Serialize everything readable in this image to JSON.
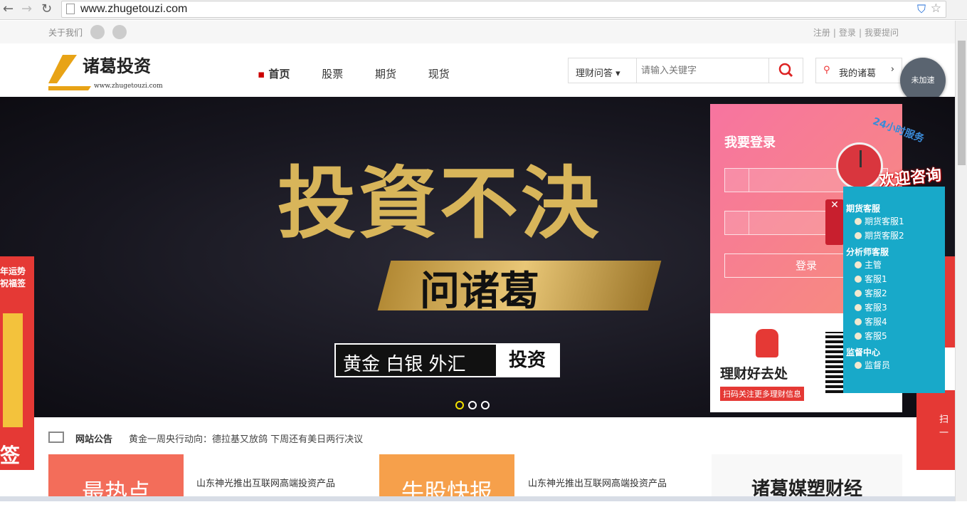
{
  "browser": {
    "url": "www.zhugetouzi.com"
  },
  "topbar": {
    "left": "关于我们",
    "links": [
      "注册",
      "登录",
      "我要提问"
    ]
  },
  "header": {
    "logo_text": "诸葛投资",
    "logo_sub": "www.zhugetouzi.com",
    "nav": [
      "首页",
      "股票",
      "期货",
      "现货"
    ],
    "search_select": "理财问答",
    "search_placeholder": "请输入关键字",
    "my_label": "我的诸葛",
    "speed_label": "未加速"
  },
  "banner": {
    "headline": "投資不決",
    "sub": "问诸葛",
    "tags": "黄金 白银 外汇",
    "tag_highlight": "投资"
  },
  "login": {
    "title": "我要登录",
    "button": "登录"
  },
  "qr": {
    "title": "理财好去处",
    "subtitle": "扫码关注更多理财信息"
  },
  "service": {
    "badge": "24小时服务",
    "welcome": "欢迎咨询",
    "groups": [
      {
        "title": "期货客服",
        "items": [
          "期货客服1",
          "期货客服2"
        ]
      },
      {
        "title": "分析师客服",
        "items": [
          "主管",
          "客服1",
          "客服2",
          "客服3",
          "客服4",
          "客服5"
        ]
      },
      {
        "title": "监督中心",
        "items": [
          "监督员"
        ]
      }
    ]
  },
  "side": {
    "left_top": "年运势",
    "left_sub": "祝福签",
    "left_bottom": "签",
    "right_bottom": "扫一"
  },
  "notice": {
    "label": "网站公告",
    "text": "黄金一周央行动向：德拉基又放鸽 下周还有美日两行决议"
  },
  "cards": {
    "c1": "最热点",
    "l1": "山东神光推出互联网高端投资产品",
    "c2": "牛股快报",
    "l2": "山东神光推出互联网高端投资产品",
    "c3": "诸葛媒塑财经"
  },
  "colors": {
    "accent": "#c00000",
    "service": "#18a9c9",
    "login": "#f774a0"
  }
}
